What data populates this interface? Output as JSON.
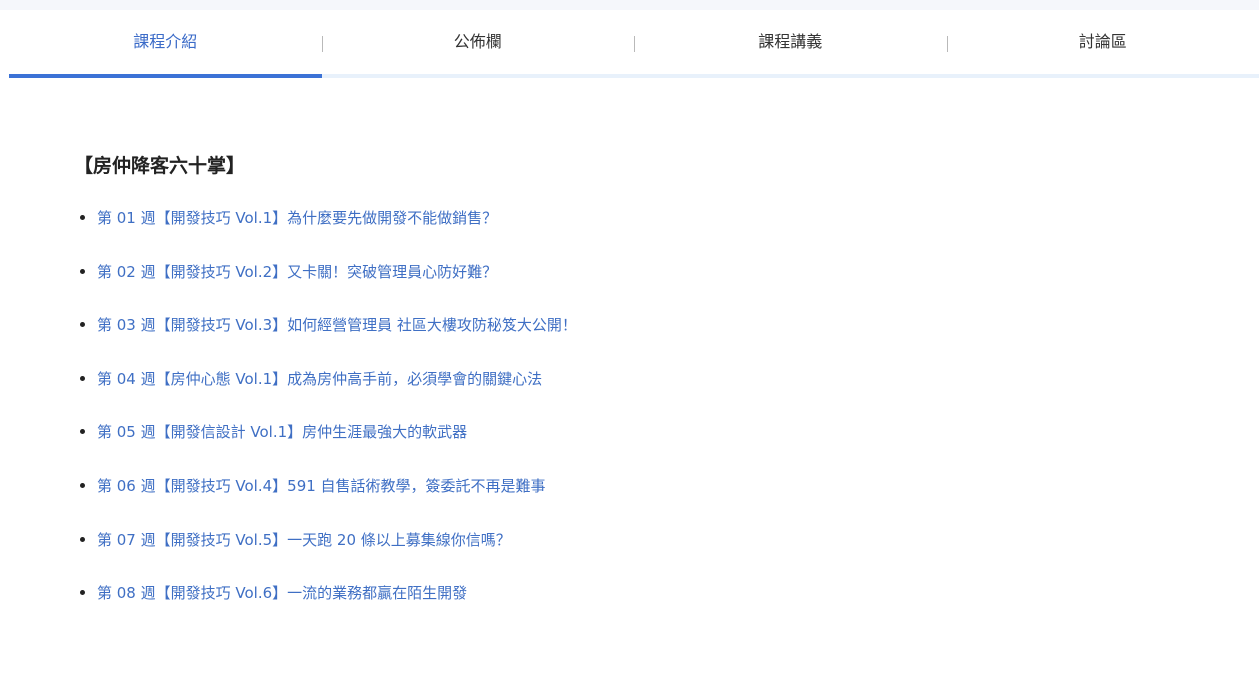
{
  "tabs": [
    {
      "label": "課程介紹",
      "active": true
    },
    {
      "label": "公佈欄",
      "active": false
    },
    {
      "label": "課程講義",
      "active": false
    },
    {
      "label": "討論區",
      "active": false
    }
  ],
  "section": {
    "title": "【房仲降客六十掌】"
  },
  "lessons": [
    "第 01 週【開發技巧 Vol.1】為什麼要先做開發不能做銷售？",
    "第 02 週【開發技巧 Vol.2】又卡關！突破管理員心防好難？",
    "第 03 週【開發技巧 Vol.3】如何經營管理員 社區大樓攻防秘笈大公開！",
    "第 04 週【房仲心態 Vol.1】成為房仲高手前，必須學會的關鍵心法",
    "第 05 週【開發信設計 Vol.1】房仲生涯最強大的軟武器",
    "第 06 週【開發技巧 Vol.4】591 自售話術教學，簽委託不再是難事",
    "第 07 週【開發技巧 Vol.5】一天跑 20 條以上募集線你信嗎？",
    "第 08 週【開發技巧 Vol.6】一流的業務都贏在陌生開發"
  ],
  "colors": {
    "accent": "#3b72d6",
    "link": "#3f6fc4",
    "tab_underline_track": "#e8f1fb"
  }
}
